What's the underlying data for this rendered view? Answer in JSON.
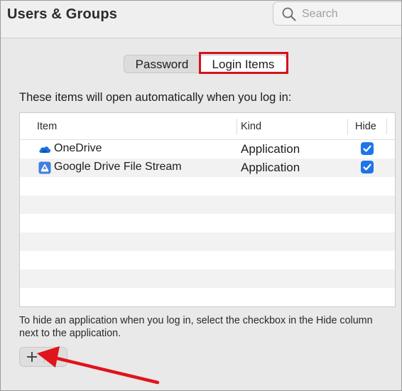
{
  "window": {
    "title": "Users & Groups"
  },
  "search": {
    "placeholder": "Search",
    "value": ""
  },
  "tabs": [
    {
      "label": "Password",
      "selected": false
    },
    {
      "label": "Login Items",
      "selected": true
    }
  ],
  "login_items": {
    "intro": "These items will open automatically when you log in:",
    "columns": [
      "Item",
      "Kind",
      "Hide"
    ],
    "rows": [
      {
        "icon": "onedrive-cloud-icon",
        "item": "OneDrive",
        "kind": "Application",
        "hide": true
      },
      {
        "icon": "google-drive-icon",
        "item": "Google Drive File Stream",
        "kind": "Application",
        "hide": true
      }
    ],
    "footnote": "To hide an application when you log in, select the checkbox in the Hide column next to the application."
  },
  "controls": {
    "add_icon": "plus-icon"
  },
  "colors": {
    "highlight": "#d5121c",
    "checkbox": "#1f74e8",
    "annotation_arrow": "#e0141c"
  }
}
